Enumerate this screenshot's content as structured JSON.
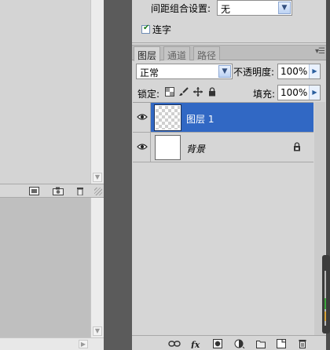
{
  "character_panel": {
    "spacing_label": "间距组合设置:",
    "spacing_value": "无",
    "ligature_label": "连字",
    "ligature_checked": true
  },
  "layers_panel": {
    "tabs": [
      {
        "label": "图层",
        "active": true
      },
      {
        "label": "通道",
        "active": false
      },
      {
        "label": "路径",
        "active": false
      }
    ],
    "blend_mode": "正常",
    "opacity_label": "不透明度:",
    "opacity_value": "100%",
    "lock_label": "锁定:",
    "fill_label": "填充:",
    "fill_value": "100%",
    "layers": [
      {
        "name": "图层 1",
        "selected": true,
        "visible": true,
        "transparent": true,
        "locked": false
      },
      {
        "name": "背景",
        "selected": false,
        "visible": true,
        "transparent": false,
        "locked": true
      }
    ],
    "bottom_icons": [
      "link-icon",
      "fx-icon",
      "mask-icon",
      "adjustment-icon",
      "group-icon",
      "new-layer-icon",
      "trash-icon"
    ]
  },
  "left_statusbar_icons": [
    "film-icon",
    "camera-icon",
    "trash-icon"
  ],
  "colors": {
    "selection": "#3168c4",
    "dock_background": "#d6d6d6",
    "workspace": "#5b5b5b"
  }
}
